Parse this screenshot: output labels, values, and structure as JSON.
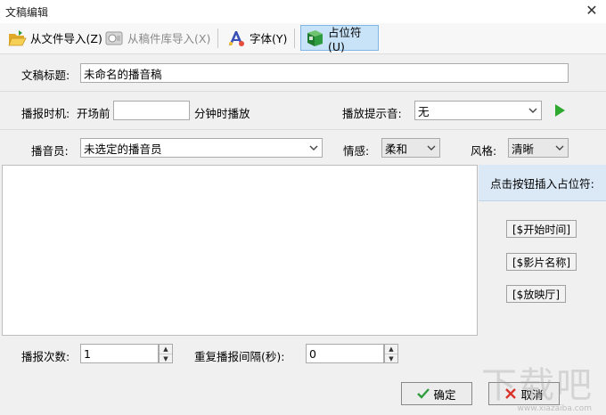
{
  "window": {
    "title": "文稿编辑",
    "close_glyph": "✕"
  },
  "toolbar": {
    "import_file": "从文件导入(Z)",
    "import_library": "从稿件库导入(X)",
    "font": "字体(Y)",
    "placeholder": "占位符(U)"
  },
  "form": {
    "title_label": "文稿标题:",
    "title_value": "未命名的播音稿",
    "time_label": "播报时机:",
    "before_label": "开场前",
    "minutes_value": "",
    "minutes_suffix": "分钟时播放",
    "prompt_label": "播放提示音:",
    "prompt_value": "无",
    "announcer_label": "播音员:",
    "announcer_value": "未选定的播音员",
    "emotion_label": "情感:",
    "emotion_value": "柔和",
    "style_label": "风格:",
    "style_value": "清晰"
  },
  "sidebar": {
    "header": "点击按钮插入占位符:",
    "buttons": [
      "[$开始时间]",
      "[$影片名称]",
      "[$放映厅]"
    ]
  },
  "bottom": {
    "count_label": "播报次数:",
    "count_value": "1",
    "interval_label": "重复播报间隔(秒):",
    "interval_value": "0",
    "ok": "确定",
    "cancel": "取消"
  },
  "watermark": {
    "main": "下载吧",
    "sub": "www.xiazaiba.com"
  },
  "colors": {
    "active_tab": "#c8e2f7",
    "play_green": "#2ea82e",
    "sidebar_header": "#dbe9f6"
  }
}
